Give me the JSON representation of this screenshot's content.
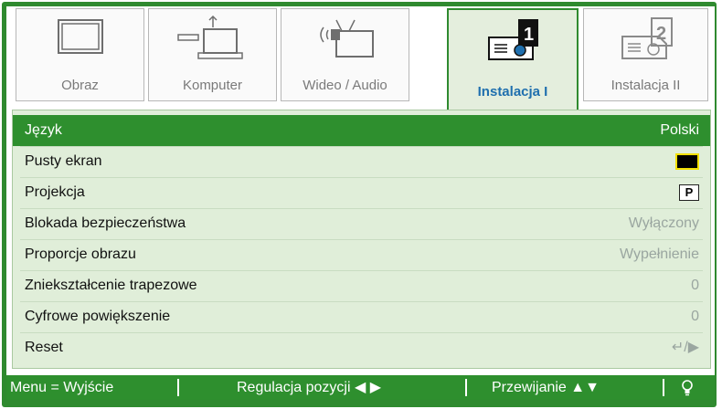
{
  "tabs": [
    {
      "label": "Obraz",
      "icon": "monitor-icon",
      "active": false
    },
    {
      "label": "Komputer",
      "icon": "computer-icon",
      "active": false
    },
    {
      "label": "Wideo / Audio",
      "icon": "video-audio-icon",
      "active": false
    },
    {
      "label": "Instalacja I",
      "icon": "projector-1-icon",
      "active": true
    },
    {
      "label": "Instalacja II",
      "icon": "projector-2-icon",
      "active": false
    }
  ],
  "menu": {
    "items": [
      {
        "label": "Język",
        "value": "Polski"
      },
      {
        "label": "Pusty ekran",
        "value": ""
      },
      {
        "label": "Projekcja",
        "value": "P"
      },
      {
        "label": "Blokada bezpieczeństwa",
        "value": "Wyłączony"
      },
      {
        "label": "Proporcje obrazu",
        "value": "Wypełnienie"
      },
      {
        "label": "Zniekształcenie trapezowe",
        "value": "0"
      },
      {
        "label": "Cyfrowe powiększenie",
        "value": "0"
      },
      {
        "label": "Reset",
        "value": "↵/▶"
      }
    ]
  },
  "status": {
    "menu": "Menu = Wyjście",
    "adjust": "Regulacja pozycji ◀ ▶",
    "scroll": "Przewijanie ▲▼",
    "icon": "lamp-icon"
  },
  "colors": {
    "frame": "#2f8a2f",
    "selected_row": "#2e8f2e",
    "menu_bg": "#e0eed9",
    "active_label": "#1f6fae"
  }
}
